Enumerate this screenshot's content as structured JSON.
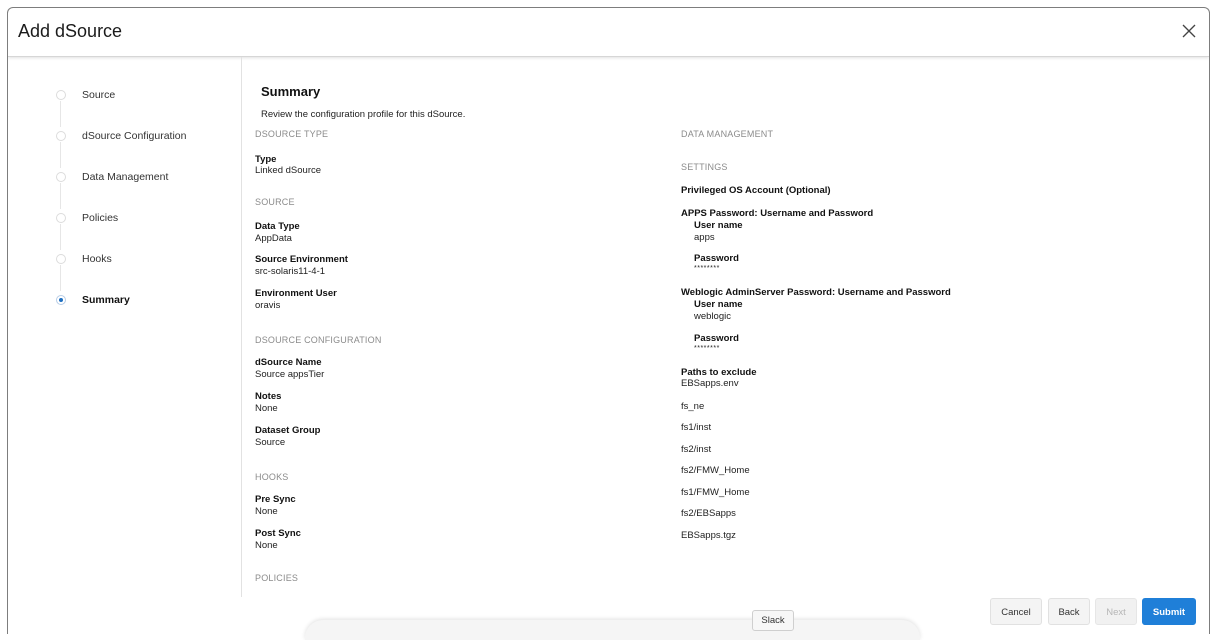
{
  "dialog": {
    "title": "Add dSource"
  },
  "steps": [
    {
      "label": "Source",
      "active": false
    },
    {
      "label": "dSource Configuration",
      "active": false
    },
    {
      "label": "Data Management",
      "active": false
    },
    {
      "label": "Policies",
      "active": false
    },
    {
      "label": "Hooks",
      "active": false
    },
    {
      "label": "Summary",
      "active": true
    }
  ],
  "summary": {
    "title": "Summary",
    "description": "Review the configuration profile for this dSource."
  },
  "left": {
    "dsource_type": {
      "heading": "DSOURCE TYPE",
      "type_label": "Type",
      "type_value": "Linked dSource"
    },
    "source": {
      "heading": "SOURCE",
      "data_type_label": "Data Type",
      "data_type_value": "AppData",
      "env_label": "Source Environment",
      "env_value": "src-solaris11-4-1",
      "user_label": "Environment User",
      "user_value": "oravis"
    },
    "config": {
      "heading": "DSOURCE CONFIGURATION",
      "name_label": "dSource Name",
      "name_value": "Source appsTier",
      "notes_label": "Notes",
      "notes_value": "None",
      "group_label": "Dataset Group",
      "group_value": "Source"
    },
    "hooks": {
      "heading": "HOOKS",
      "pre_label": "Pre Sync",
      "pre_value": "None",
      "post_label": "Post Sync",
      "post_value": "None"
    },
    "policies": {
      "heading": "POLICIES"
    }
  },
  "right": {
    "data_management_heading": "DATA MANAGEMENT",
    "settings_heading": "SETTINGS",
    "privileged": "Privileged OS Account (Optional)",
    "apps": {
      "heading": "APPS Password: Username and Password",
      "user_label": "User name",
      "user_value": "apps",
      "password_label": "Password",
      "password_value": "********"
    },
    "weblogic": {
      "heading": "Weblogic AdminServer Password: Username and Password",
      "user_label": "User name",
      "user_value": "weblogic",
      "password_label": "Password",
      "password_value": "********"
    },
    "paths_label": "Paths to exclude",
    "paths": [
      "EBSapps.env",
      "fs_ne",
      "fs1/inst",
      "fs2/inst",
      "fs2/FMW_Home",
      "fs1/FMW_Home",
      "fs2/EBSapps",
      "EBSapps.tgz"
    ]
  },
  "footer": {
    "cancel": "Cancel",
    "back": "Back",
    "next": "Next",
    "submit": "Submit"
  },
  "tooltip": "Slack",
  "colors": {
    "accent": "#1f7fd8",
    "step_active": "#1f6fc1"
  }
}
